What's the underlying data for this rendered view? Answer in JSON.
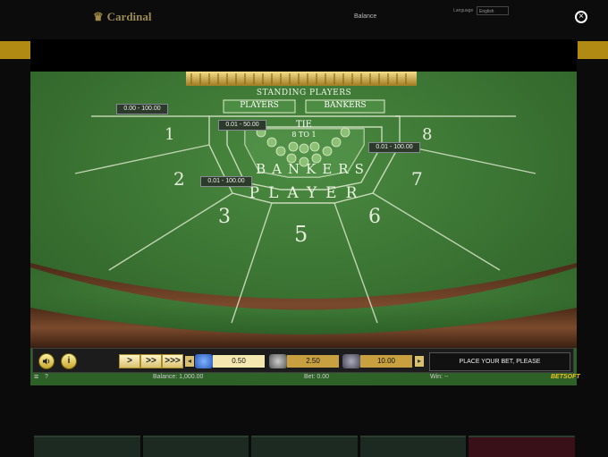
{
  "site": {
    "logo": "Cardinal",
    "balance_label": "Balance",
    "language_label": "Language",
    "language_value": "English"
  },
  "close_glyph": "×",
  "table": {
    "standing_players": "STANDING PLAYERS",
    "players": "PLAYERS",
    "bankers": "BANKERS",
    "tie": "TIE",
    "tie_odds": "8 TO 1",
    "seats": [
      "1",
      "2",
      "3",
      "5",
      "6",
      "7",
      "8"
    ],
    "player_word": "PLAYER",
    "banker_word": "BANKERS",
    "limits": [
      "0.00 - 100.00",
      "0.01 - 50.00",
      "0.01 - 100.00",
      "0.01 - 100.00"
    ],
    "felt_color": "#3c7a34",
    "rail_color": "#6b4228"
  },
  "controls": {
    "sound_icon": "speaker-icon",
    "info_glyph": "i",
    "speed_glyphs": [
      ">",
      ">>",
      ">>>"
    ],
    "prev_glyph": "◂",
    "next_glyph": "▸",
    "chips": [
      "0.50",
      "2.50",
      "10.00"
    ],
    "place_bet": "PLACE YOUR BET, PLEASE"
  },
  "status": {
    "menu_glyph": "≡",
    "help_glyph": "?",
    "balance": "Balance: 1,000.00",
    "bet": "Bet: 0.00",
    "win": "Win: --",
    "brand": "BETSOFT"
  }
}
